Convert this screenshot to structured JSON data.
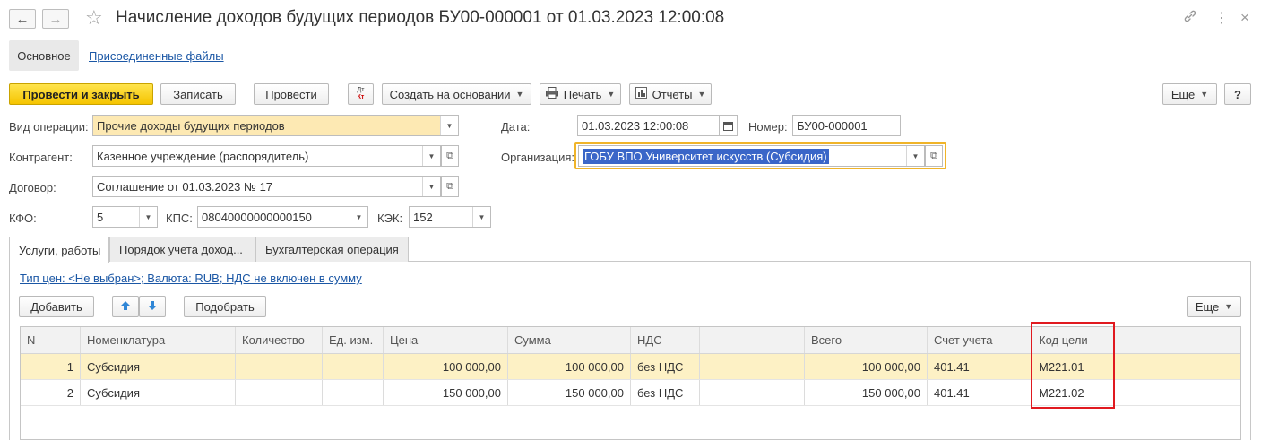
{
  "window": {
    "title": "Начисление доходов будущих периодов БУ00-000001 от 01.03.2023 12:00:08",
    "icons": [
      "back-arrow-icon",
      "forward-arrow-icon",
      "star-icon",
      "link-icon",
      "more-vert-icon",
      "close-icon"
    ]
  },
  "sections": {
    "main": "Основное",
    "files": "Присоединенные файлы"
  },
  "toolbar": {
    "post_close": "Провести и закрыть",
    "save": "Записать",
    "post": "Провести",
    "dt_kt_top": "Дт",
    "dt_kt_bottom": "Кт",
    "create_based": "Создать на основании",
    "print": "Печать",
    "reports": "Отчеты",
    "more": "Еще",
    "help": "?"
  },
  "form": {
    "operation_label": "Вид операции:",
    "operation_value": "Прочие доходы будущих периодов",
    "date_label": "Дата:",
    "date_value": "01.03.2023 12:00:08",
    "number_label": "Номер:",
    "number_value": "БУ00-000001",
    "counterparty_label": "Контрагент:",
    "counterparty_value": "Казенное учреждение (распорядитель)",
    "organization_label": "Организация:",
    "organization_value": "ГОБУ ВПО Университет искусств (Субсидия)",
    "contract_label": "Договор:",
    "contract_value": "Соглашение от 01.03.2023 № 17",
    "kfo_label": "КФО:",
    "kfo_value": "5",
    "kps_label": "КПС:",
    "kps_value": "08040000000000150",
    "kek_label": "КЭК:",
    "kek_value": "152"
  },
  "tabs": [
    {
      "label": "Услуги, работы",
      "active": true
    },
    {
      "label": "Порядок учета доход...",
      "active": false
    },
    {
      "label": "Бухгалтерская операция",
      "active": false
    }
  ],
  "services": {
    "price_info": "Тип цен: <Не выбран>; Валюта: RUB; НДС не включен в сумму",
    "add": "Добавить",
    "pick": "Подобрать",
    "more": "Еще",
    "columns": [
      "N",
      "Номенклатура",
      "Количество",
      "Ед. изм.",
      "Цена",
      "Сумма",
      "НДС",
      "",
      "Всего",
      "Счет учета",
      "Код цели"
    ],
    "rows": [
      {
        "n": "1",
        "item": "Субсидия",
        "qty": "",
        "unit": "",
        "price": "100 000,00",
        "sum": "100 000,00",
        "vat": "без НДС",
        "vat_sum": "",
        "total": "100 000,00",
        "account": "401.41",
        "goal": "М221.01"
      },
      {
        "n": "2",
        "item": "Субсидия",
        "qty": "",
        "unit": "",
        "price": "150 000,00",
        "sum": "150 000,00",
        "vat": "без НДС",
        "vat_sum": "",
        "total": "150 000,00",
        "account": "401.41",
        "goal": "М221.02"
      }
    ]
  },
  "colors": {
    "primary_button": "#f5c400",
    "highlight_field": "#fde9b3",
    "selected_row": "#fdf1c5",
    "focus_border": "#f0b429",
    "annotation_box": "#e0191f",
    "link": "#1b57a5"
  }
}
